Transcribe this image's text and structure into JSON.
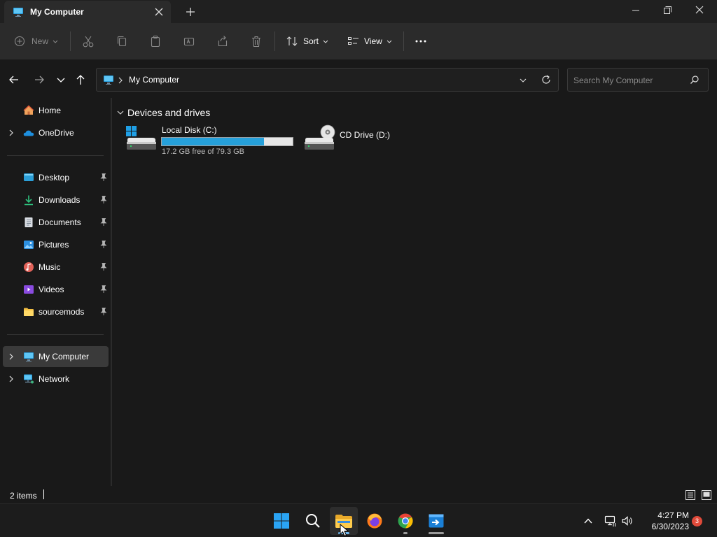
{
  "window": {
    "tab_title": "My Computer"
  },
  "toolbar": {
    "new_label": "New",
    "sort_label": "Sort",
    "view_label": "View"
  },
  "address": {
    "path": "My Computer",
    "search_placeholder": "Search My Computer"
  },
  "sidebar": {
    "items": [
      {
        "label": "Home",
        "icon": "home-icon"
      },
      {
        "label": "OneDrive",
        "icon": "onedrive-icon"
      },
      {
        "label": "Desktop",
        "icon": "desktop-icon",
        "pinned": true
      },
      {
        "label": "Downloads",
        "icon": "downloads-icon",
        "pinned": true
      },
      {
        "label": "Documents",
        "icon": "documents-icon",
        "pinned": true
      },
      {
        "label": "Pictures",
        "icon": "pictures-icon",
        "pinned": true
      },
      {
        "label": "Music",
        "icon": "music-icon",
        "pinned": true
      },
      {
        "label": "Videos",
        "icon": "videos-icon",
        "pinned": true
      },
      {
        "label": "sourcemods",
        "icon": "folder-icon",
        "pinned": true
      },
      {
        "label": "My Computer",
        "icon": "computer-icon",
        "selected": true
      },
      {
        "label": "Network",
        "icon": "network-icon"
      }
    ]
  },
  "main": {
    "group_title": "Devices and drives",
    "drives": [
      {
        "name": "Local Disk (C:)",
        "info": "17.2 GB free of 79.3 GB",
        "used_fraction": 0.783
      },
      {
        "name": "CD Drive (D:)"
      }
    ]
  },
  "status": {
    "items_count": "2 items"
  },
  "taskbar": {
    "time": "4:27 PM",
    "date": "6/30/2023",
    "notification_count": "3"
  },
  "colors": {
    "accent": "#26a0da",
    "background": "#191919",
    "chrome": "#2b2b2b"
  }
}
